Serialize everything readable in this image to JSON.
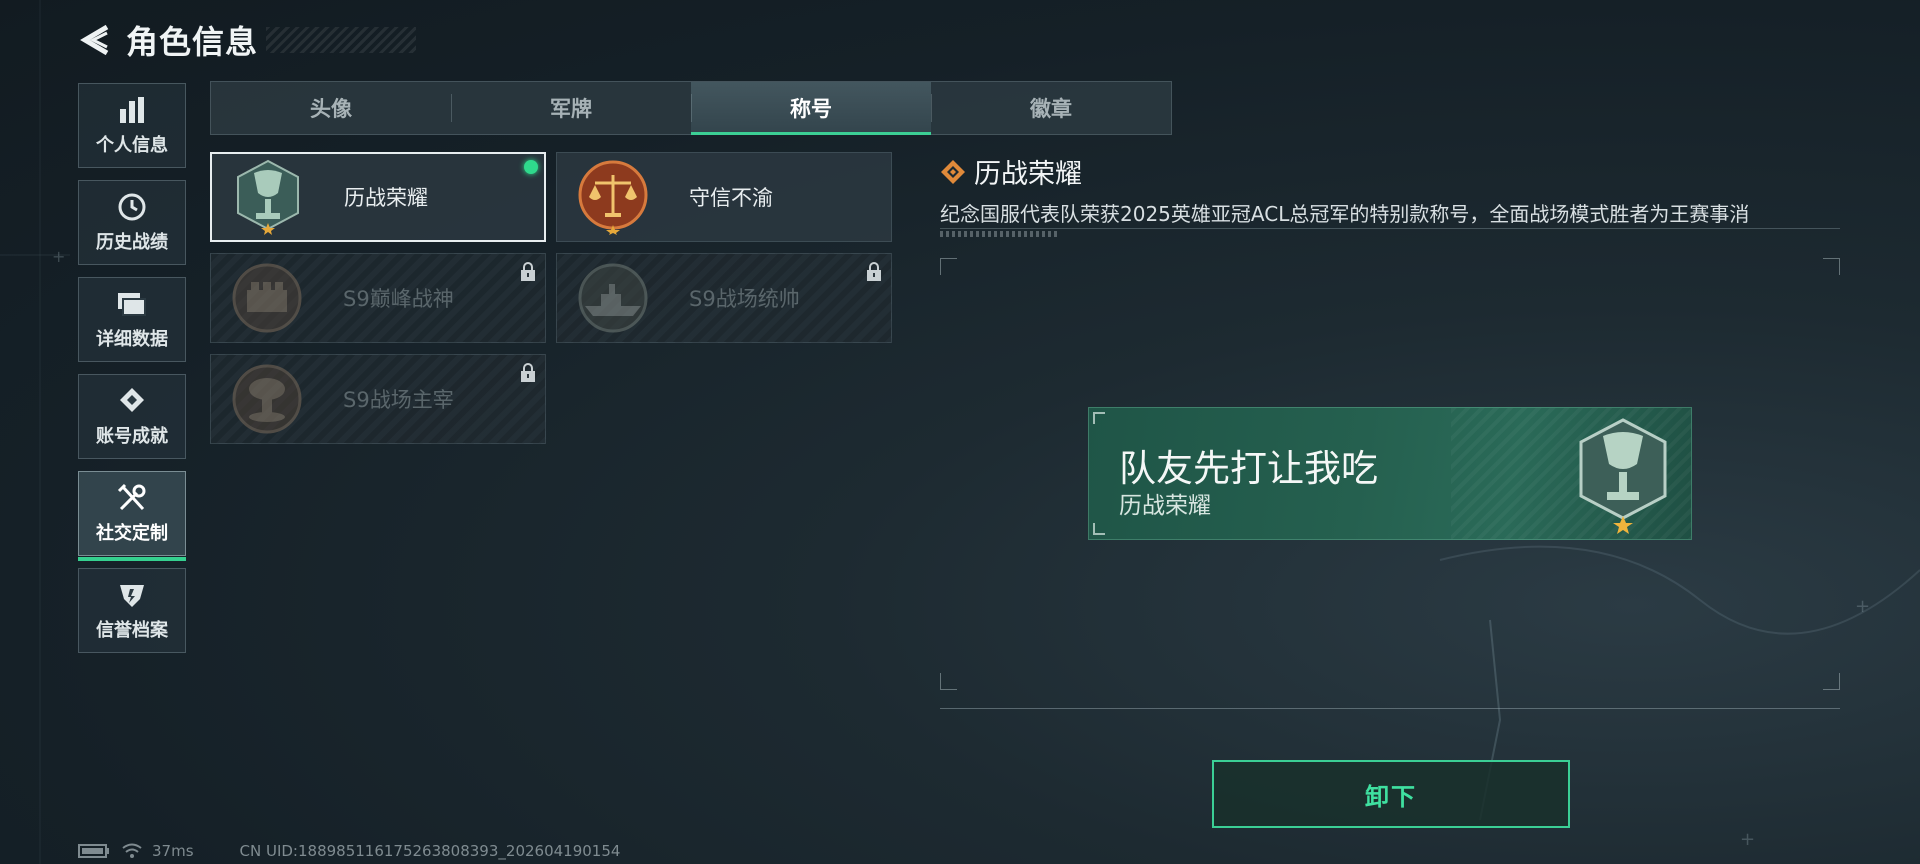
{
  "header": {
    "title": "角色信息",
    "back_icon": "back-arrow-icon"
  },
  "sidebar": {
    "items": [
      {
        "label": "个人信息",
        "icon": "bar-chart-icon",
        "active": false
      },
      {
        "label": "历史战绩",
        "icon": "history-clock-icon",
        "active": false
      },
      {
        "label": "详细数据",
        "icon": "folder-icon",
        "active": false
      },
      {
        "label": "账号成就",
        "icon": "achievement-icon",
        "active": false
      },
      {
        "label": "社交定制",
        "icon": "tools-icon",
        "active": true
      },
      {
        "label": "信誉档案",
        "icon": "shield-icon",
        "active": false
      }
    ]
  },
  "tabs": [
    {
      "label": "头像",
      "active": false
    },
    {
      "label": "军牌",
      "active": false
    },
    {
      "label": "称号",
      "active": true
    },
    {
      "label": "徽章",
      "active": false
    }
  ],
  "titles": [
    {
      "name": "历战荣耀",
      "emblem": "trophy-emblem-icon",
      "selected": true,
      "equipped": true,
      "locked": false
    },
    {
      "name": "守信不渝",
      "emblem": "scales-emblem-icon",
      "selected": false,
      "equipped": false,
      "locked": false
    },
    {
      "name": "S9巅峰战神",
      "emblem": "fortress-emblem-icon",
      "selected": false,
      "equipped": false,
      "locked": true
    },
    {
      "name": "S9战场统帅",
      "emblem": "warship-emblem-icon",
      "selected": false,
      "equipped": false,
      "locked": true
    },
    {
      "name": "S9战场主宰",
      "emblem": "mushroom-cloud-emblem-icon",
      "selected": false,
      "equipped": false,
      "locked": true
    }
  ],
  "detail": {
    "title": "历战荣耀",
    "description": "纪念国服代表队荣获2025英雄亚冠ACL总冠军的特别款称号，全面战场模式胜者为王赛事消",
    "preview": {
      "player_name": "队友先打让我吃",
      "title": "历战荣耀"
    },
    "unequip_label": "卸下"
  },
  "status": {
    "ping": "37ms",
    "uid": "CN UID:188985116175263808393_202604190154"
  },
  "colors": {
    "accent": "#3ccf95",
    "equipped_dot": "#2fd98c",
    "nameplate": "#25604f"
  }
}
